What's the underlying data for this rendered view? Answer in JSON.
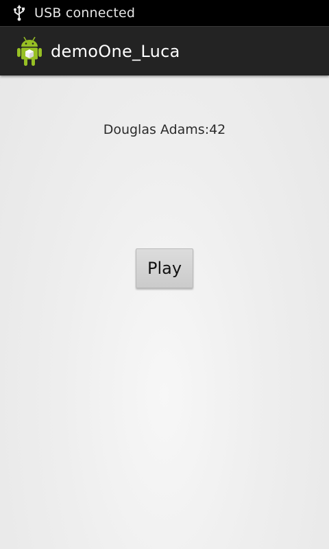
{
  "status_bar": {
    "icon": "usb-icon",
    "text": "USB connected"
  },
  "action_bar": {
    "icon": "android-app-icon",
    "title": "demoOne_Luca"
  },
  "main": {
    "quote": "Douglas Adams:42",
    "play_button_label": "Play"
  },
  "colors": {
    "status_bar_bg": "#000000",
    "action_bar_bg": "#232323",
    "android_green": "#97c024",
    "background": "#eeeeee"
  }
}
